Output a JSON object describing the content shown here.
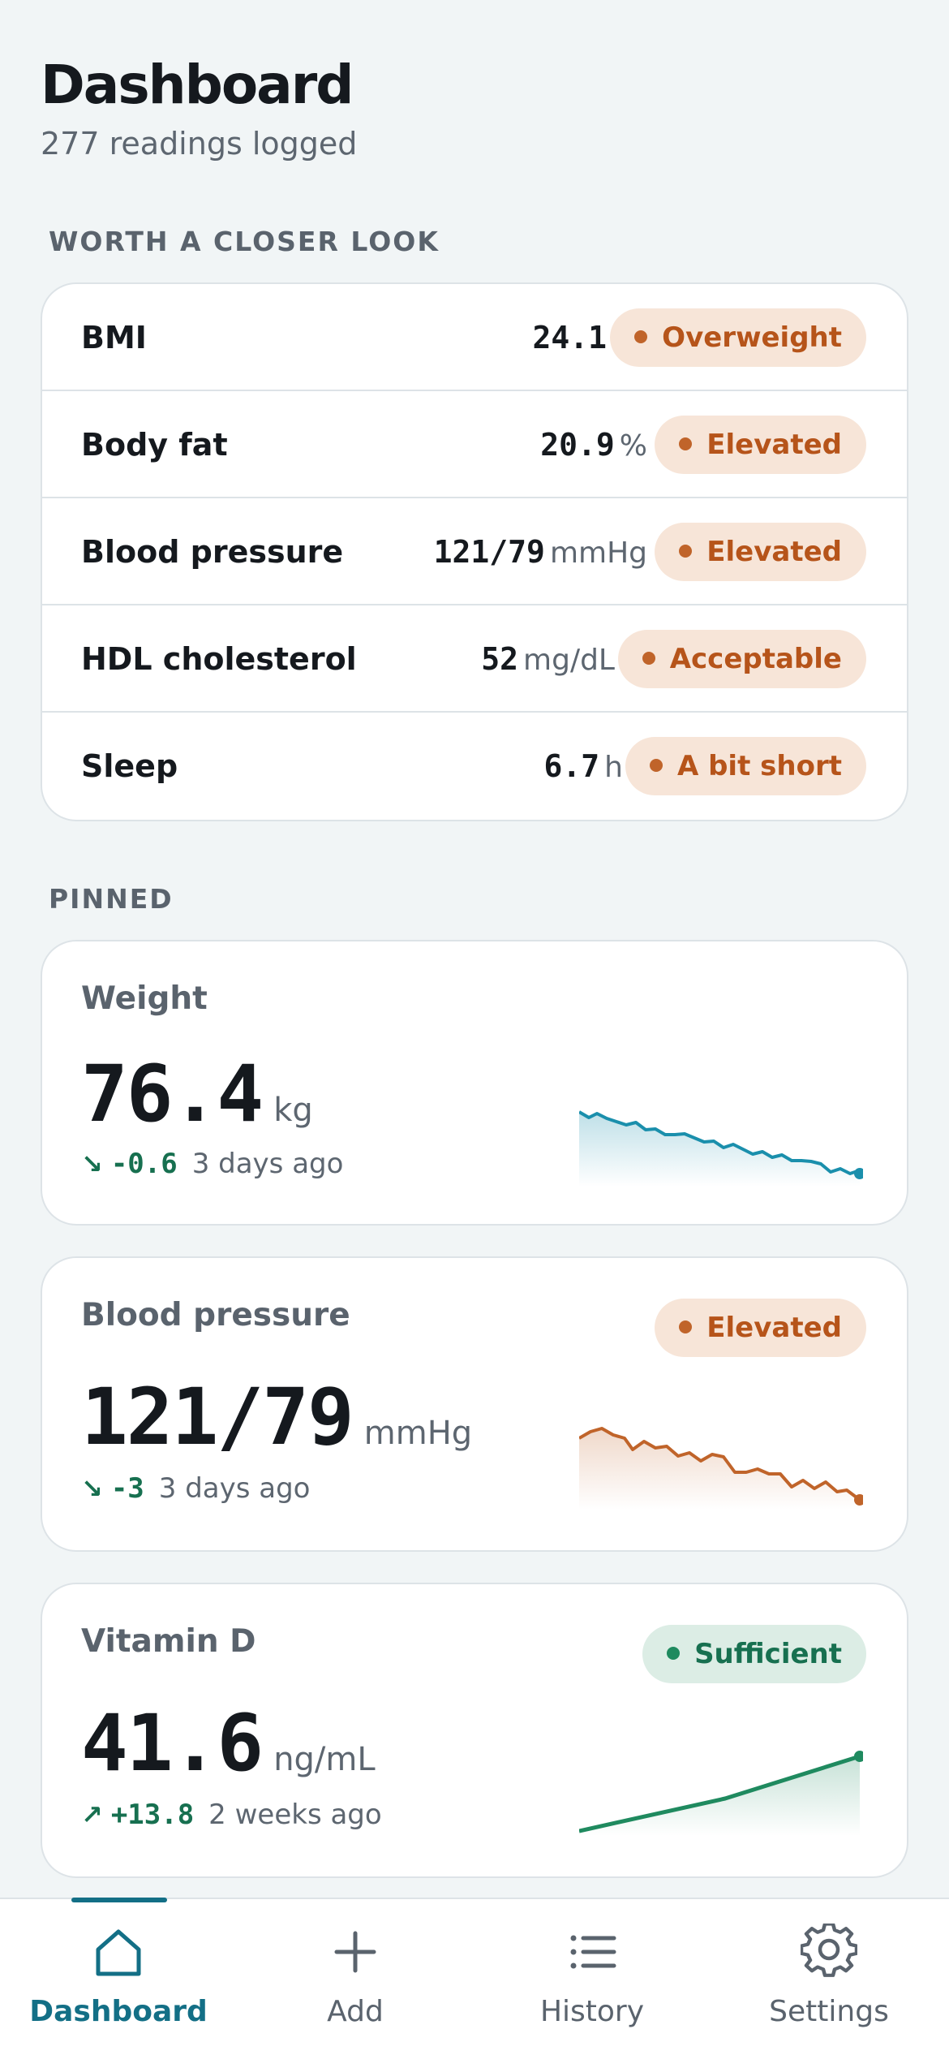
{
  "header": {
    "title": "Dashboard",
    "subtitle": "277 readings logged"
  },
  "sections": {
    "closer_look": "WORTH A CLOSER LOOK",
    "pinned": "PINNED"
  },
  "closer_look": [
    {
      "name": "BMI",
      "value": "24.1",
      "unit": "",
      "status": "Overweight"
    },
    {
      "name": "Body fat",
      "value": "20.9",
      "unit": "%",
      "status": "Elevated"
    },
    {
      "name": "Blood pressure",
      "value": "121/79",
      "unit": "mmHg",
      "status": "Elevated"
    },
    {
      "name": "HDL cholesterol",
      "value": "52",
      "unit": "mg/dL",
      "status": "Acceptable"
    },
    {
      "name": "Sleep",
      "value": "6.7",
      "unit": "h",
      "status": "A bit short"
    }
  ],
  "pinned": [
    {
      "name": "Weight",
      "value": "76.4",
      "unit": "kg",
      "delta": "-0.6",
      "when": "3 days ago",
      "status": "",
      "trend_icon": "trend-down-icon",
      "spark_color": "#1a8fac"
    },
    {
      "name": "Blood pressure",
      "value": "121/79",
      "unit": "mmHg",
      "delta": "-3",
      "when": "3 days ago",
      "status": "Elevated",
      "trend_icon": "trend-down-icon",
      "spark_color": "#c0642a"
    },
    {
      "name": "Vitamin D",
      "value": "41.6",
      "unit": "ng/mL",
      "delta": "+13.8",
      "when": "2 weeks ago",
      "status": "Sufficient",
      "trend_icon": "trend-up-icon",
      "spark_color": "#1f8a5f"
    }
  ],
  "tabs": [
    {
      "label": "Dashboard",
      "icon": "home-icon",
      "active": true
    },
    {
      "label": "Add",
      "icon": "plus-icon",
      "active": false
    },
    {
      "label": "History",
      "icon": "list-icon",
      "active": false
    },
    {
      "label": "Settings",
      "icon": "gear-icon",
      "active": false
    }
  ],
  "colors": {
    "accent": "#136f86",
    "warn": "#b6541a",
    "good": "#177050",
    "background": "#f1f5f6"
  }
}
